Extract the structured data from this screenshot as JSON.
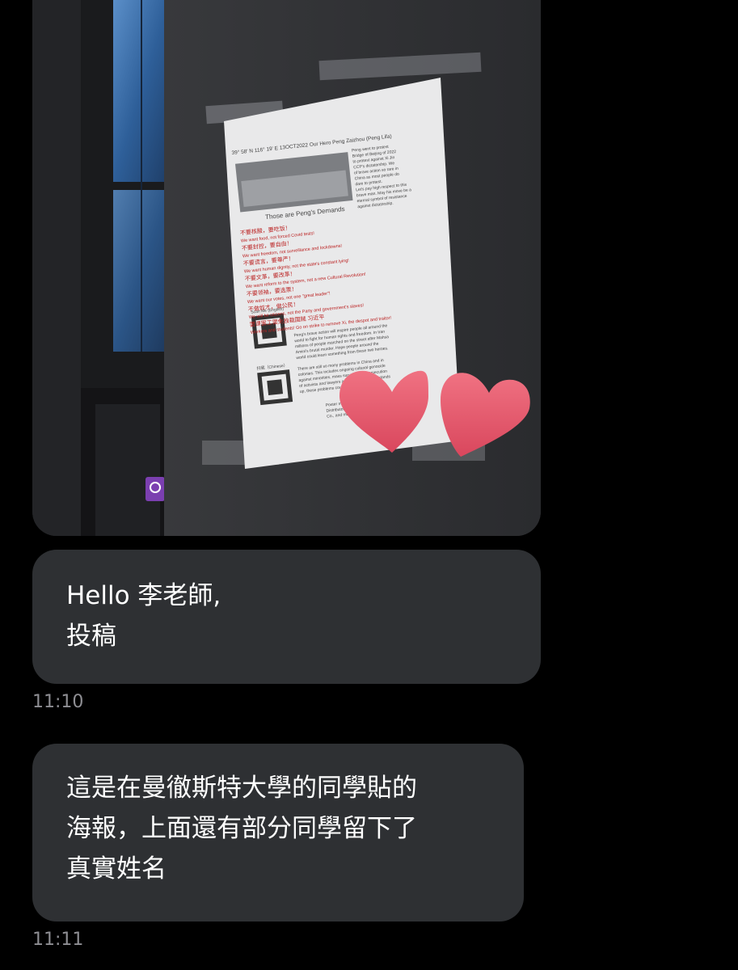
{
  "photo": {
    "description_icon": "photo-attachment",
    "poster": {
      "header": "39° 58' N 116° 19' E   13OCT2022   Our Hero Peng Zaizhou (Peng Lifa)",
      "intro": [
        "Peng went to protest",
        "Bridge of Beijing of 2022",
        "to protest against Xi Jin",
        "CCP's dictatorship. We",
        "of brave action so rare in",
        "China as most people do",
        "dare to protest.",
        "Let's pay high respect to this",
        "brave man. May his move be a",
        "eternal symbol of resistance",
        "against dictatorship."
      ],
      "demands_title": "Those are Peng's Demands",
      "demands": [
        {
          "zh": "不要核酸，要吃饭！",
          "en": "We want food, not forced Covid tests!"
        },
        {
          "zh": "不要封控，要自由！",
          "en": "We want freedom, not surveillance and lockdowns!"
        },
        {
          "zh": "不要谎言，要尊严！",
          "en": "We want human dignity, not the state's constant lying!"
        },
        {
          "zh": "不要文革，要改革！",
          "en": "We want reform to the system, not a new Cultural Revolution!"
        },
        {
          "zh": "不要领袖，要选票！",
          "en": "We want our votes, not one \"great leader\"!"
        },
        {
          "zh": "不做奴才，做公民！",
          "en": "We will be citizens, not the Party and government's slaves!"
        },
        {
          "zh": "罢课罢工罢免独裁国贼 习近平",
          "en": "Workers and students! Go on strike to remove Xi, the despot and traitor!"
        }
      ],
      "para1": [
        "Peng's brave action will inspire people all around the",
        "world to fight for human rights and freedom. In Iran",
        "millions of people marched on the street after Mahsa",
        "Amini's brutal murder. Hope people around the",
        "world could learn something from these two heroes."
      ],
      "para2": [
        "There are still so many problems in China and in",
        "colonies. This includes ongoing cultural genocide",
        "against minorities, mass surveillance, persecution",
        "of activists and lawyers and more. If nobody stands",
        "up, these problems could never"
      ],
      "qr_en": "Scan Me (English)",
      "qr_zh": "扫我（Chinese）",
      "footer": [
        "Poster maker:",
        "Distributors: So",
        "Co., and more"
      ]
    }
  },
  "messages": [
    {
      "lines": [
        "Hello 李老師,",
        "投稿"
      ],
      "time": "11:10"
    },
    {
      "lines": [
        "這是在曼徹斯特大學的同學貼的",
        "海報，上面還有部分同學留下了",
        "真實姓名"
      ],
      "time": "11:11"
    }
  ],
  "colors": {
    "background": "#000000",
    "bubble": "#2e3033",
    "text": "#ffffff",
    "timestamp": "#8e8e93",
    "heart": "#e8566b",
    "sign": "#7b3fb0"
  }
}
